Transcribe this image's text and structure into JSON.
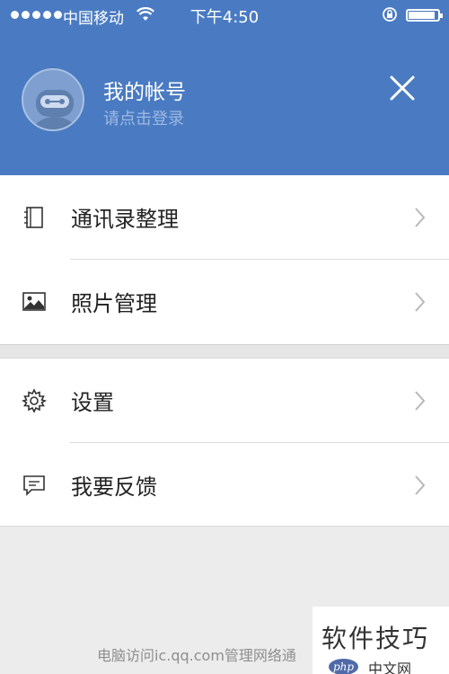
{
  "status_bar": {
    "carrier": "中国移动",
    "time": "下午4:50",
    "battery_level": 0.95
  },
  "header": {
    "title": "我的帐号",
    "subtitle": "请点击登录"
  },
  "menu_group_1": {
    "items": [
      {
        "label": "通讯录整理",
        "icon": "address-book-icon"
      },
      {
        "label": "照片管理",
        "icon": "photo-icon"
      }
    ]
  },
  "menu_group_2": {
    "items": [
      {
        "label": "设置",
        "icon": "gear-icon"
      },
      {
        "label": "我要反馈",
        "icon": "feedback-icon"
      }
    ]
  },
  "footer": {
    "text": "电脑访问ic.qq.com管理网络通"
  },
  "watermark": {
    "title": "软件技巧",
    "php": "php",
    "site": "中文网"
  },
  "colors": {
    "header_bg": "#4a7bc2",
    "background": "#ececec"
  }
}
